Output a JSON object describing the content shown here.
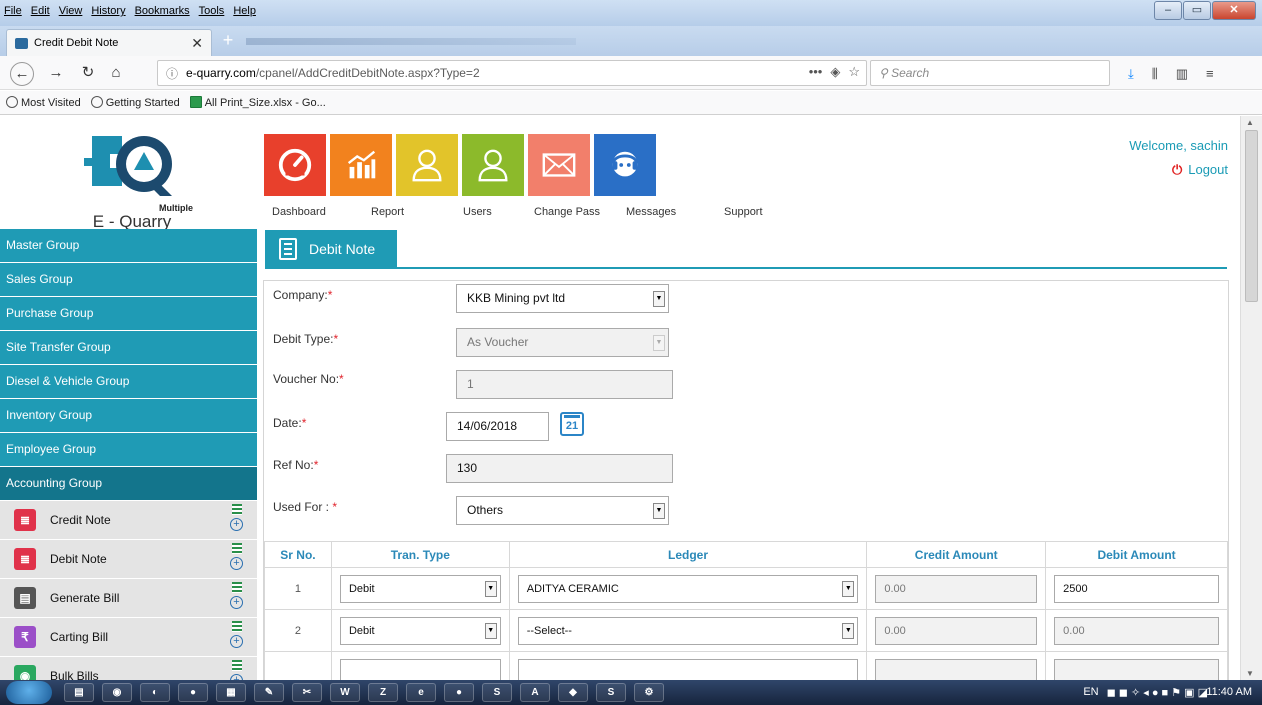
{
  "browser": {
    "menu": [
      "File",
      "Edit",
      "View",
      "History",
      "Bookmarks",
      "Tools",
      "Help"
    ],
    "tab_title": "Credit Debit Note",
    "url_prefix": "e-quarry.com",
    "url_path": "/cpanel/AddCreditDebitNote.aspx?Type=2",
    "search_placeholder": "Search",
    "bookmarks": [
      "Most Visited",
      "Getting Started",
      "All Print_Size.xlsx - Go..."
    ]
  },
  "header": {
    "logo_sub": "Multiple",
    "logo_name": "E - Quarry",
    "tiles": [
      {
        "label": "Dashboard",
        "color": "#e8402c",
        "icon": "dashboard-icon"
      },
      {
        "label": "Report",
        "color": "#f2821e",
        "icon": "report-icon"
      },
      {
        "label": "Users",
        "color": "#e2c42a",
        "icon": "users-icon"
      },
      {
        "label": "Change Pass",
        "color": "#8cba2b",
        "icon": "change-pass-icon"
      },
      {
        "label": "Messages",
        "color": "#f27f6b",
        "icon": "messages-icon"
      },
      {
        "label": "Support",
        "color": "#2a6fc6",
        "icon": "support-icon"
      }
    ],
    "welcome": "Welcome, sachin",
    "logout": "Logout"
  },
  "sidebar": {
    "groups": [
      "Master Group",
      "Sales Group",
      "Purchase Group",
      "Site Transfer Group",
      "Diesel & Vehicle Group",
      "Inventory Group",
      "Employee Group",
      "Accounting Group"
    ],
    "items": [
      {
        "label": "Credit Note",
        "color": "#e0324a"
      },
      {
        "label": "Debit Note",
        "color": "#e0324a"
      },
      {
        "label": "Generate Bill",
        "color": "#555555"
      },
      {
        "label": "Carting Bill",
        "color": "#9b4fc8"
      },
      {
        "label": "Bulk Bills",
        "color": "#2aa860"
      }
    ]
  },
  "content": {
    "tab": "Debit Note",
    "company_label": "Company:",
    "company_value": "KKB Mining pvt ltd",
    "debit_type_label": "Debit Type:",
    "debit_type_value": "As Voucher",
    "voucher_label": "Voucher No:",
    "voucher_value": "1",
    "date_label": "Date:",
    "date_value": "14/06/2018",
    "calendar_day": "21",
    "ref_label": "Ref No:",
    "ref_value": "130",
    "used_label": "Used For : ",
    "used_value": "Others",
    "required_mark": "*",
    "table": {
      "headers": [
        "Sr No.",
        "Tran. Type",
        "Ledger",
        "Credit Amount",
        "Debit Amount"
      ],
      "rows": [
        {
          "sr": "1",
          "type": "Debit",
          "ledger": "ADITYA CERAMIC",
          "credit": "0.00",
          "debit": "2500"
        },
        {
          "sr": "2",
          "type": "Debit",
          "ledger": "--Select--",
          "credit": "0.00",
          "debit": "0.00"
        }
      ]
    }
  },
  "taskbar": {
    "lang": "EN",
    "clock": "11:40 AM"
  }
}
